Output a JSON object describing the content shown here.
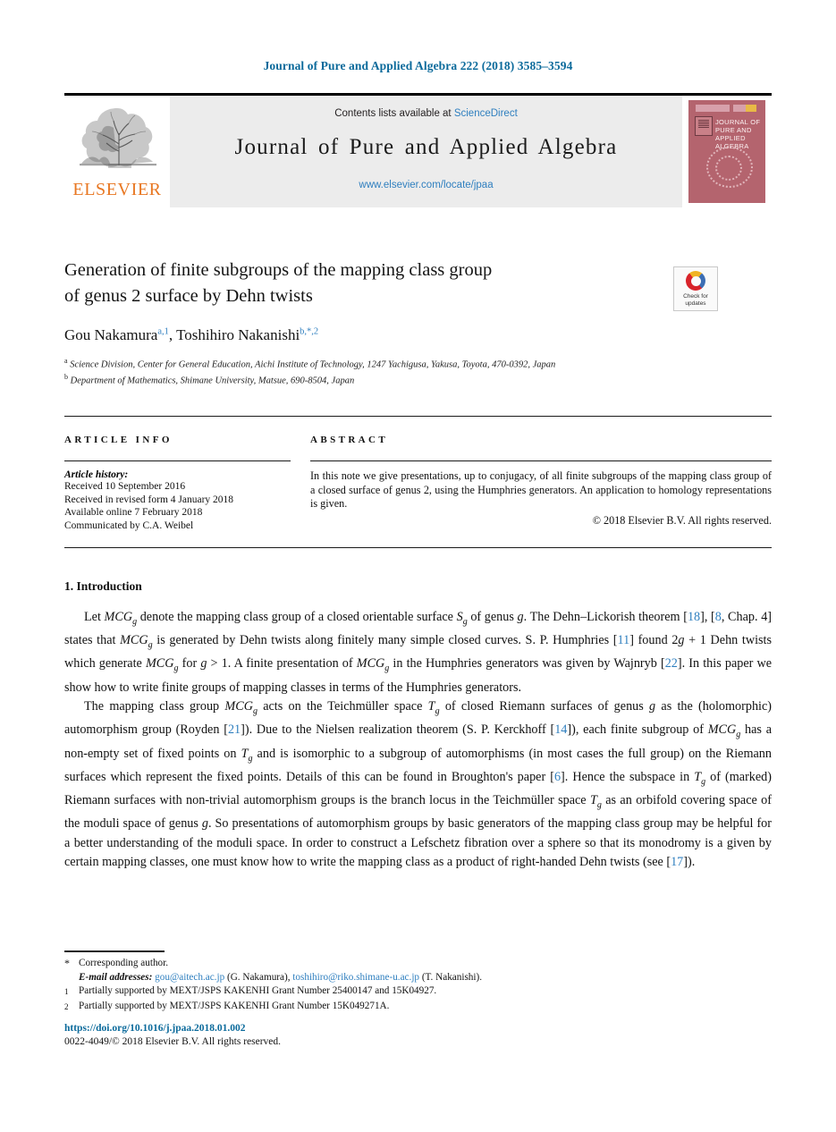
{
  "running_head": "Journal of Pure and Applied Algebra 222 (2018) 3585–3594",
  "masthead": {
    "contents_prefix": "Contents lists available at ",
    "contents_link": "ScienceDirect",
    "journal_title": "Journal of Pure and Applied Algebra",
    "journal_url": "www.elsevier.com/locate/jpaa",
    "publisher_wordmark": "ELSEVIER",
    "cover_title_lines": [
      "JOURNAL OF",
      "PURE AND",
      "APPLIED ALGEBRA"
    ]
  },
  "article": {
    "title_line1": "Generation of finite subgroups of the mapping class group",
    "title_line2": "of genus 2 surface by Dehn twists",
    "authors_plain": "Gou Nakamura",
    "author1_sup": "a,1",
    "authors_plain2": ", Toshihiro Nakanishi",
    "author2_sup": "b,*,2",
    "affiliation_a": "Science Division, Center for General Education, Aichi Institute of Technology, 1247 Yachigusa, Yakusa, Toyota, 470-0392, Japan",
    "affiliation_b": "Department of Mathematics, Shimane University, Matsue, 690-8504, Japan"
  },
  "crossmark": {
    "line1": "Check for",
    "line2": "updates"
  },
  "info": {
    "label": "ARTICLE INFO",
    "history_heading": "Article history:",
    "history_lines": [
      "Received 10 September 2016",
      "Received in revised form 4 January 2018",
      "Available online 7 February 2018",
      "Communicated by C.A. Weibel"
    ]
  },
  "abstract": {
    "label": "ABSTRACT",
    "body": "In this note we give presentations, up to conjugacy, of all finite subgroups of the mapping class group of a closed surface of genus 2, using the Humphries generators. An application to homology representations is given.",
    "copyright": "© 2018 Elsevier B.V. All rights reserved."
  },
  "body": {
    "section_heading": "1. Introduction",
    "paragraph1_a": "Let ",
    "paragraph1_b": " denote the mapping class group of a closed orientable surface ",
    "paragraph1_c": " of genus ",
    "paragraph1_d": ". The Dehn–Lickorish theorem [18], [8, Chap. 4] states that ",
    "paragraph1_e": " is generated by Dehn twists along finitely many simple closed curves. S. P. Humphries [11] found 2g + 1 Dehn twists which generate ",
    "paragraph1_f": " for g > 1. A finite presentation of ",
    "paragraph1_g": " in the Humphries generators was given by Wajnryb [22]. In this paper we show how to write finite groups of mapping classes in terms of the Humphries generators.",
    "paragraph2": "The mapping class group MCGg acts on the Teichmüller space Tg of closed Riemann surfaces of genus g as the (holomorphic) automorphism group (Royden [21]). Due to the Nielsen realization theorem (S. P. Kerckhoff [14]), each finite subgroup of MCGg has a non-empty set of fixed points on Tg and is isomorphic to a subgroup of automorphisms (in most cases the full group) on the Riemann surfaces which represent the fixed points. Details of this can be found in Broughton's paper [6]. Hence the subspace in Tg of (marked) Riemann surfaces with non-trivial automorphism groups is the branch locus in the Teichmüller space Tg as an orbifold covering space of the moduli space of genus g. So presentations of automorphism groups by basic generators of the mapping class group may be helpful for a better understanding of the moduli space. In order to construct a Lefschetz fibration over a sphere so that its monodromy is a given by certain mapping classes, one must know how to write the mapping class as a product of right-handed Dehn twists (see [17])."
  },
  "footnotes": {
    "corresponding_mark": "*",
    "corresponding_text": "Corresponding author.",
    "email_label": "E-mail addresses:",
    "email1": "gou@aitech.ac.jp",
    "email1_owner": "(G. Nakamura),",
    "email2": "toshihiro@riko.shimane-u.ac.jp",
    "email2_owner": "(T. Nakanishi).",
    "note1_mark": "1",
    "note1_text": "Partially supported by MEXT/JSPS KAKENHI Grant Number 25400147 and 15K04927.",
    "note2_mark": "2",
    "note2_text": "Partially supported by MEXT/JSPS KAKENHI Grant Number 15K049271A."
  },
  "footer": {
    "doi": "https://doi.org/10.1016/j.jpaa.2018.01.002",
    "issn_line": "0022-4049/© 2018 Elsevier B.V. All rights reserved."
  },
  "colors": {
    "link_blue": "#2f7fbf",
    "head_blue": "#0b6a9b",
    "elsevier_orange": "#E87722",
    "banner_gray": "#ececec",
    "cover_rose": "#b4646e"
  }
}
